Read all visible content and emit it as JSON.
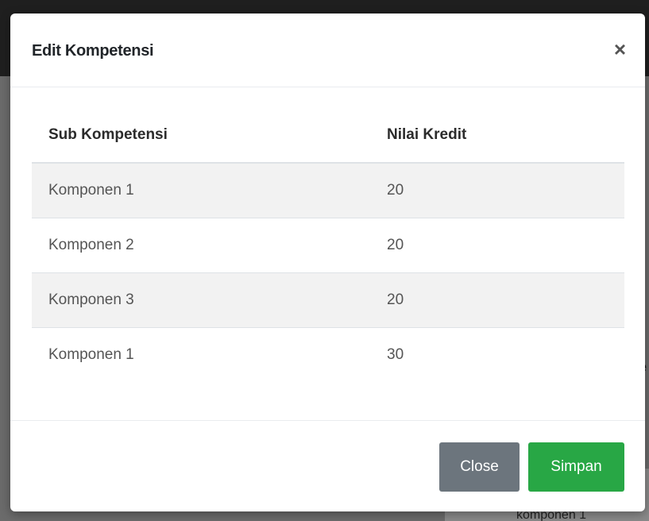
{
  "modal": {
    "title": "Edit Kompetensi",
    "close_symbol": "×",
    "close_icon": "close-icon"
  },
  "table": {
    "headers": [
      "Sub Kompetensi",
      "Nilai Kredit"
    ],
    "rows": [
      {
        "sub": "Komponen 1",
        "nilai": "20"
      },
      {
        "sub": "Komponen 2",
        "nilai": "20"
      },
      {
        "sub": "Komponen 3",
        "nilai": "20"
      },
      {
        "sub": "Komponen 1",
        "nilai": "30"
      }
    ]
  },
  "footer": {
    "close_label": "Close",
    "save_label": "Simpan"
  },
  "background": {
    "bottom_peek": "komponen 1",
    "right_peek": "e"
  },
  "colors": {
    "close_button": "#6c757d",
    "save_button": "#28a745"
  }
}
